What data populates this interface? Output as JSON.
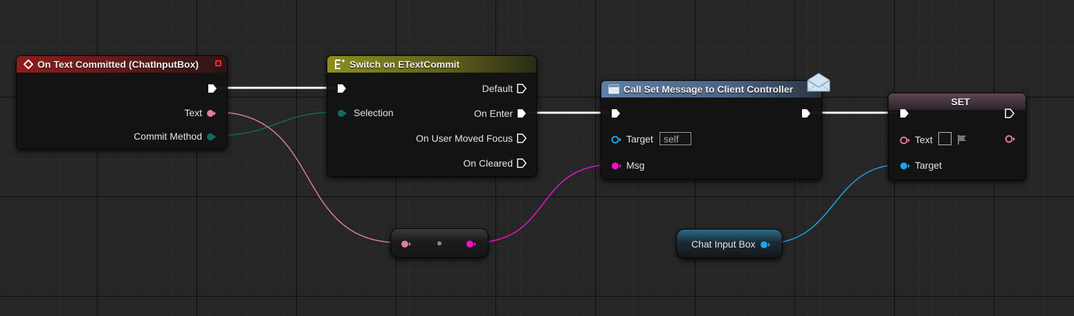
{
  "colors": {
    "exec": "#ffffff",
    "text_pin": "#e07ba7",
    "enum_pin": "#0d6e5f",
    "string_pin": "#f011c8",
    "object_pin": "#1ba6ea",
    "event_header": "#8e1d1d",
    "switch_header": "#8b8f1d",
    "call_header": "#5e7ea6",
    "set_header": "#5d4654"
  },
  "nodes": {
    "event": {
      "title": "On Text Committed (ChatInputBox)",
      "pins": {
        "text": "Text",
        "commit_method": "Commit Method"
      }
    },
    "switch": {
      "title": "Switch on ETextCommit",
      "pins": {
        "selection": "Selection",
        "default": "Default",
        "on_enter": "On Enter",
        "on_user_moved_focus": "On User Moved Focus",
        "on_cleared": "On Cleared"
      }
    },
    "call": {
      "title": "Call Set Message to Client Controller",
      "pins": {
        "target": "Target",
        "target_default": "self",
        "msg": "Msg"
      }
    },
    "set": {
      "title": "SET",
      "pins": {
        "text": "Text",
        "target": "Target"
      }
    },
    "variable": {
      "label": "Chat Input Box"
    }
  },
  "icons": [
    "event-diamond-icon",
    "switch-enum-icon",
    "function-icon",
    "message-envelope-icon",
    "flag-icon"
  ]
}
